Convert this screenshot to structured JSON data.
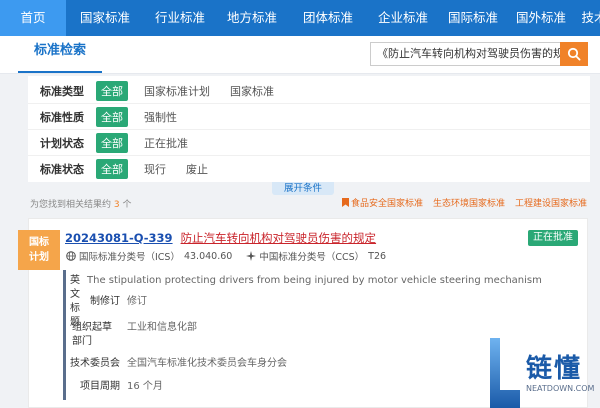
{
  "nav": {
    "items": [
      "首页",
      "国家标准",
      "行业标准",
      "地方标准",
      "团体标准",
      "企业标准",
      "国际标准",
      "国外标准",
      "技术"
    ],
    "active_index": 0
  },
  "search": {
    "section_title": "标准检索",
    "query": "《防止汽车转向机构对驾驶员伤害的规定》"
  },
  "filters": [
    {
      "label": "标准类型",
      "selected": "全部",
      "options": [
        "国家标准计划",
        "国家标准"
      ]
    },
    {
      "label": "标准性质",
      "selected": "全部",
      "options": [
        "强制性"
      ]
    },
    {
      "label": "计划状态",
      "selected": "全部",
      "options": [
        "正在批准"
      ]
    },
    {
      "label": "标准状态",
      "selected": "全部",
      "options": [
        "现行",
        "废止"
      ]
    }
  ],
  "expand_label": "展开条件",
  "results": {
    "prefix": "为您找到相关结果约",
    "count": "3",
    "suffix": "个",
    "quick_links": [
      "食品安全国家标准",
      "生态环境国家标准",
      "工程建设国家标准"
    ]
  },
  "item": {
    "badge_line1": "国标",
    "badge_line2": "计划",
    "code": "20243081-Q-339",
    "name": "防止汽车转向机构对驾驶员伤害的规定",
    "status": "正在批准",
    "ics_label": "国际标准分类号（ICS）",
    "ics_value": "43.040.60",
    "ccs_label": "中国标准分类号（CCS）",
    "ccs_value": "T26",
    "details": [
      {
        "key": "英文标题",
        "value": "The stipulation protecting drivers from being injured by motor vehicle steering mechanism"
      },
      {
        "key": "制修订",
        "value": "修订"
      },
      {
        "key": "组织起草部门",
        "value": "工业和信息化部"
      },
      {
        "key": "技术委员会",
        "value": "全国汽车标准化技术委员会车身分会"
      },
      {
        "key": "项目周期",
        "value": "16 个月"
      }
    ]
  },
  "watermark": {
    "text": "链懂",
    "sub": "NEATDOWN.COM"
  },
  "colors": {
    "nav": "#1a73c8",
    "accent": "#f08229",
    "status": "#2aa876",
    "title": "#c9242b"
  }
}
